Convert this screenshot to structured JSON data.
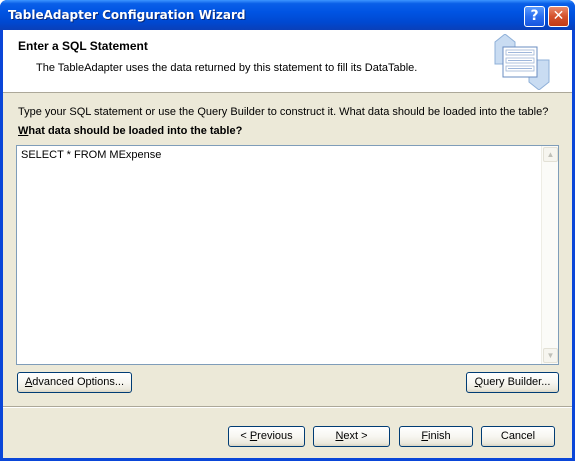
{
  "window": {
    "title": "TableAdapter Configuration Wizard",
    "help_glyph": "?",
    "close_glyph": "✕"
  },
  "header": {
    "title": "Enter a SQL Statement",
    "subtitle": "The TableAdapter uses the data returned by this statement to fill its DataTable."
  },
  "body": {
    "instruction": "Type your SQL statement or use the Query Builder to construct it. What data should be loaded into the table?",
    "question_accel": "W",
    "question_rest": "hat data should be loaded into the table?",
    "sql_text": "SELECT * FROM MExpense"
  },
  "buttons": {
    "advanced": {
      "accel": "A",
      "rest": "dvanced Options..."
    },
    "query_builder": {
      "accel": "Q",
      "rest": "uery Builder..."
    },
    "previous": {
      "prefix": "< ",
      "accel": "P",
      "rest": "revious"
    },
    "next": {
      "accel": "N",
      "rest": "ext >"
    },
    "finish": {
      "accel": "F",
      "rest": "inish"
    },
    "cancel": {
      "label": "Cancel"
    }
  },
  "colors": {
    "titlebar": "#0054e3",
    "client_bg": "#ece9d8",
    "header_bg": "#ffffff",
    "button_border": "#003c74",
    "textbox_border": "#7f9db9"
  },
  "icons": {
    "header_graphic": "wizard-database-icon",
    "help": "help-icon",
    "close": "close-icon",
    "scroll_up": "scroll-up-arrow-icon",
    "scroll_down": "scroll-down-arrow-icon"
  }
}
